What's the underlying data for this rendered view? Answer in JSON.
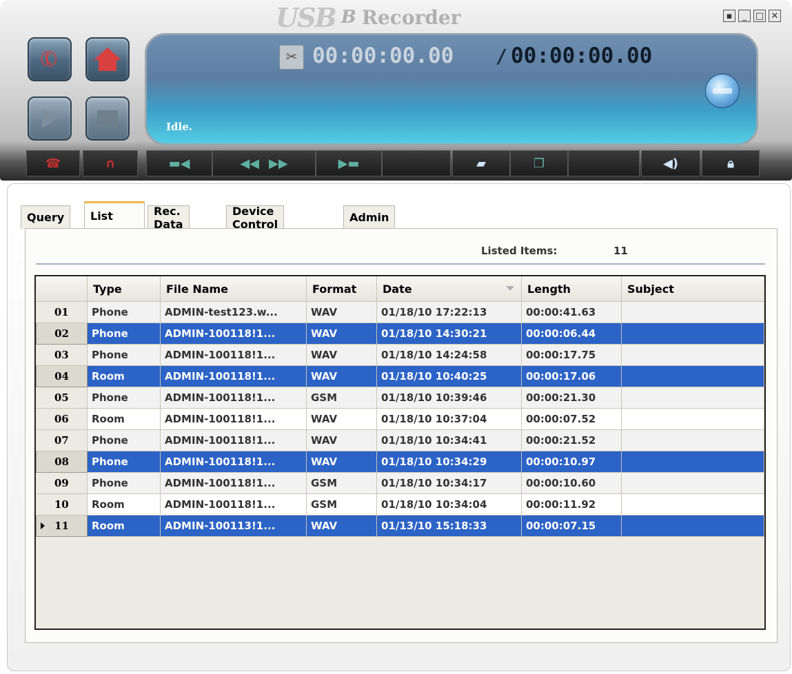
{
  "app": {
    "logo_main": "USB",
    "logo_accent": "B",
    "logo_title": "Recorder"
  },
  "window_buttons": [
    "minimize-to-tray",
    "minimize",
    "maximize",
    "close"
  ],
  "player": {
    "current_time": "00:00:00.00",
    "separator": "/",
    "total_time": "00:00:00.00",
    "status": "Idle."
  },
  "tabs": [
    {
      "label": "Query"
    },
    {
      "label": "List"
    },
    {
      "label": "Rec. Data"
    },
    {
      "label": "Device Control"
    },
    {
      "label": "Admin"
    }
  ],
  "active_tab": "List",
  "listed": {
    "label": "Listed Items:",
    "count": "11"
  },
  "table": {
    "columns": [
      "",
      "Type",
      "File Name",
      "Format",
      "Date",
      "Length",
      "Subject"
    ],
    "rows": [
      {
        "num": "01",
        "type": "Phone",
        "file": "ADMIN-test123.w...",
        "format": "WAV",
        "date": "01/18/10 17:22:13",
        "length": "00:00:41.63",
        "subject": ""
      },
      {
        "num": "02",
        "type": "Phone",
        "file": "ADMIN-100118!1...",
        "format": "WAV",
        "date": "01/18/10 14:30:21",
        "length": "00:00:06.44",
        "subject": ""
      },
      {
        "num": "03",
        "type": "Phone",
        "file": "ADMIN-100118!1...",
        "format": "WAV",
        "date": "01/18/10 14:24:58",
        "length": "00:00:17.75",
        "subject": ""
      },
      {
        "num": "04",
        "type": "Room",
        "file": "ADMIN-100118!1...",
        "format": "WAV",
        "date": "01/18/10 10:40:25",
        "length": "00:00:17.06",
        "subject": ""
      },
      {
        "num": "05",
        "type": "Phone",
        "file": "ADMIN-100118!1...",
        "format": "GSM",
        "date": "01/18/10 10:39:46",
        "length": "00:00:21.30",
        "subject": ""
      },
      {
        "num": "06",
        "type": "Room",
        "file": "ADMIN-100118!1...",
        "format": "WAV",
        "date": "01/18/10 10:37:04",
        "length": "00:00:07.52",
        "subject": ""
      },
      {
        "num": "07",
        "type": "Phone",
        "file": "ADMIN-100118!1...",
        "format": "WAV",
        "date": "01/18/10 10:34:41",
        "length": "00:00:21.52",
        "subject": ""
      },
      {
        "num": "08",
        "type": "Phone",
        "file": "ADMIN-100118!1...",
        "format": "WAV",
        "date": "01/18/10 10:34:29",
        "length": "00:00:10.97",
        "subject": ""
      },
      {
        "num": "09",
        "type": "Phone",
        "file": "ADMIN-100118!1...",
        "format": "GSM",
        "date": "01/18/10 10:34:17",
        "length": "00:00:10.60",
        "subject": ""
      },
      {
        "num": "10",
        "type": "Room",
        "file": "ADMIN-100118!1...",
        "format": "GSM",
        "date": "01/18/10 10:34:04",
        "length": "00:00:11.92",
        "subject": ""
      },
      {
        "num": "11",
        "type": "Room",
        "file": "ADMIN-100113!1...",
        "format": "WAV",
        "date": "01/13/10 15:18:33",
        "length": "00:00:07.15",
        "subject": ""
      }
    ],
    "selected_rows": [
      "02",
      "04",
      "08",
      "11"
    ],
    "current_row": "11",
    "selection_color": "#2c63c6"
  }
}
